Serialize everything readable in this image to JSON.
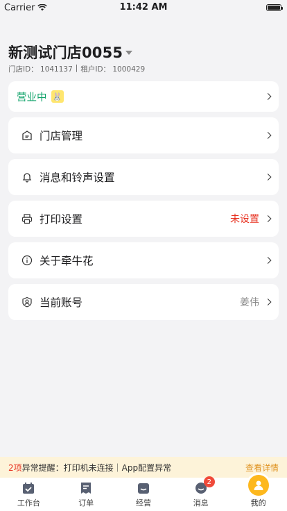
{
  "status_bar": {
    "carrier": "Carrier",
    "time": "11:42 AM"
  },
  "store": {
    "name": "新测试门店0055",
    "store_id": "门店ID： 1041137",
    "separator": "|",
    "tenant_id": "租户ID： 1000429"
  },
  "business": {
    "status": "营业中"
  },
  "menu": {
    "store_manage": {
      "label": "门店管理",
      "icon": "store-icon"
    },
    "message_ringtone": {
      "label": "消息和铃声设置",
      "icon": "bell-icon"
    },
    "print": {
      "label": "打印设置",
      "value": "未设置",
      "icon": "printer-icon"
    },
    "about": {
      "label": "关于牵牛花",
      "icon": "info-icon"
    },
    "account": {
      "label": "当前账号",
      "value": "姜伟",
      "icon": "user-icon"
    }
  },
  "alert": {
    "count": "2项",
    "text": "异常提醒：打印机未连接｜App配置异常",
    "action": "查看详情"
  },
  "tabs": {
    "workbench": "工作台",
    "orders": "订单",
    "operations": "经营",
    "messages": "消息",
    "messages_badge": "2",
    "mine": "我的"
  },
  "colors": {
    "accent": "#fdb81e",
    "open_status": "#10a36a",
    "warning": "#e7301f",
    "alert_bg": "#fdf3d9"
  }
}
